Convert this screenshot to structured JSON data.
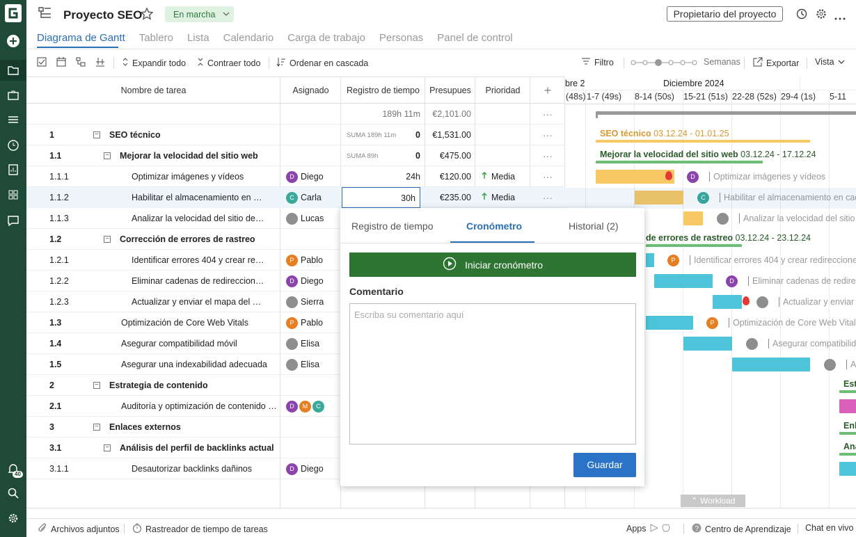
{
  "project": {
    "title": "Proyecto SEO",
    "status": "En marcha",
    "owner_button": "Propietario del proyecto"
  },
  "tabs": [
    "Diagrama de Gantt",
    "Tablero",
    "Lista",
    "Calendario",
    "Carga de trabajo",
    "Personas",
    "Panel de control"
  ],
  "toolbar": {
    "expand": "Expandir todo",
    "collapse": "Contraer todo",
    "cascade": "Ordenar en cascada",
    "filter": "Filtro",
    "zoom_label": "Semanas",
    "export": "Exportar",
    "view": "Vista"
  },
  "columns": {
    "name": "Nombre de tarea",
    "assignee": "Asignado",
    "time": "Registro de tiempo",
    "budget": "Presupues",
    "priority": "Prioridad"
  },
  "summary_row": {
    "time": "189h 11m",
    "budget": "€2,101.00"
  },
  "rows": [
    {
      "num": "1",
      "name": "SEO técnico",
      "sum": "SUMA 189h 11m",
      "time": "0",
      "budget": "€1,531.00"
    },
    {
      "num": "1.1",
      "name": "Mejorar la velocidad del sitio web",
      "sum": "SUMA 89h",
      "time": "0",
      "budget": "€475.00"
    },
    {
      "num": "1.1.1",
      "name": "Optimizar imágenes y vídeos",
      "assignee": "Diego",
      "time": "24h",
      "budget": "€120.00",
      "priority": "Media"
    },
    {
      "num": "1.1.2",
      "name": "Habilitar el almacenamiento en caché del navegador",
      "assignee": "Carla",
      "time": "30h",
      "budget": "€235.00",
      "priority": "Media"
    },
    {
      "num": "1.1.3",
      "name": "Analizar la velocidad del sitio después de los cambios",
      "assignee": "Lucas"
    },
    {
      "num": "1.2",
      "name": "Corrección de errores de rastreo"
    },
    {
      "num": "1.2.1",
      "name": "Identificar errores 404 y crear redirecciones",
      "assignee": "Pablo"
    },
    {
      "num": "1.2.2",
      "name": "Eliminar cadenas de redireccionamiento",
      "assignee": "Diego"
    },
    {
      "num": "1.2.3",
      "name": "Actualizar y enviar el mapa del sitio XML",
      "assignee": "Sierra"
    },
    {
      "num": "1.3",
      "name": "Optimización de Core Web Vitals",
      "assignee": "Pablo"
    },
    {
      "num": "1.4",
      "name": "Asegurar compatibilidad móvil",
      "assignee": "Elisa"
    },
    {
      "num": "1.5",
      "name": "Asegurar una indexabilidad adecuada",
      "assignee": "Elisa"
    },
    {
      "num": "2",
      "name": "Estrategia de contenido"
    },
    {
      "num": "2.1",
      "name": "Auditoría y optimización de contenido existente",
      "avatars": [
        "D",
        "M",
        "C"
      ]
    },
    {
      "num": "3",
      "name": "Enlaces externos"
    },
    {
      "num": "3.1",
      "name": "Análisis del perfil de backlinks actual"
    },
    {
      "num": "3.1.1",
      "name": "Desautorizar backlinks dañinos",
      "assignee": "Diego"
    }
  ],
  "gantt": {
    "month_prev": "bre 2",
    "month": "Diciembre 2024",
    "weeks": [
      "(48s)",
      "1-7 (49s)",
      "8-14 (50s)",
      "15-21 (51s)",
      "22-28 (52s)",
      "29-4 (1s)",
      "5-11"
    ],
    "labels": {
      "seo": "SEO técnico",
      "seo_dates": "03.12.24 - 01.01.25",
      "speed": "Mejorar la velocidad del sitio web",
      "speed_dates": "03.12.24 - 17.12.24",
      "t111": "Optimizar imágenes y vídeos",
      "t112": "Habilitar el almacenamiento en caché",
      "t113": "Analizar la velocidad del sitio",
      "crawl": "de errores de rastreo",
      "crawl_dates": "03.12.24 - 23.12.24",
      "t121": "Identificar errores 404 y crear redirecciones",
      "t122": "Eliminar cadenas de redire",
      "t123": "Actualizar y enviar",
      "t13": "Optimización de Core Web Vitals",
      "t14": "Asegurar compatibilid",
      "t15": "A",
      "est": "Est",
      "enl": "Enl",
      "ana": "Ana"
    },
    "workload": "Workload"
  },
  "popup": {
    "tabs": [
      "Registro de tiempo",
      "Cronómetro",
      "Historial (2)"
    ],
    "start": "Iniciar cronómetro",
    "comment_label": "Comentario",
    "comment_placeholder": "Escriba su comentario aquí",
    "save": "Guardar"
  },
  "footer": {
    "attachments": "Archivos adjuntos",
    "tracker": "Rastreador de tiempo de tareas",
    "apps": "Apps",
    "learning": "Centro de Aprendizaje",
    "chat": "Chat en vivo"
  },
  "notifications": "40",
  "colors": {
    "rail": "#1f4a37",
    "accent": "#2a6fb6",
    "yellow": "#f7c863",
    "cyan": "#4dc4d9",
    "green": "#2e7533",
    "pink": "#d95fb8",
    "diego": "#8b44ac",
    "carla": "#3aa99a",
    "pablo": "#e67e22",
    "maria": "#e67e22"
  }
}
